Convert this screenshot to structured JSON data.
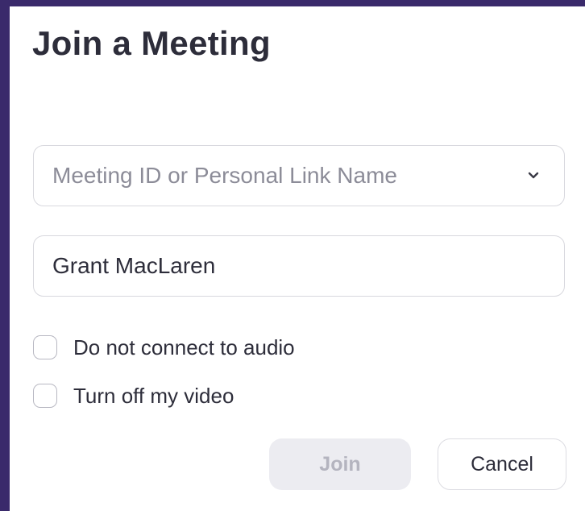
{
  "dialog": {
    "title": "Join a Meeting"
  },
  "meeting_id": {
    "placeholder": "Meeting ID or Personal Link Name",
    "value": "",
    "icon": "chevron-down-icon"
  },
  "name": {
    "value": "Grant MacLaren"
  },
  "options": {
    "audio_label": "Do not connect to audio",
    "audio_checked": false,
    "video_label": "Turn off my video",
    "video_checked": false
  },
  "buttons": {
    "join_label": "Join",
    "join_enabled": false,
    "cancel_label": "Cancel"
  },
  "colors": {
    "background": "#3a2a6b",
    "text": "#2d2d3a",
    "disabled_button": "#ececf1"
  }
}
